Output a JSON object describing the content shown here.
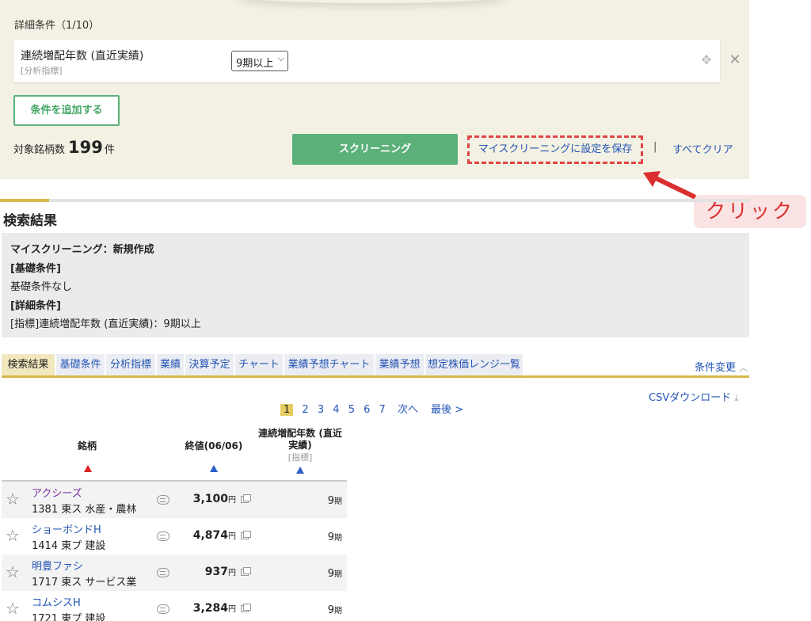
{
  "condition_panel": {
    "heading": "詳細条件（1/10）",
    "condition": {
      "name": "連続増配年数 (直近実績)",
      "sub": "[分析指標]",
      "selected_value": "9期以上"
    },
    "add_button": "条件を追加する",
    "target_label": "対象銘柄数",
    "target_count": "199",
    "target_unit": "件",
    "screening_button": "スクリーニング",
    "save_link": "マイスクリーニングに設定を保存",
    "separator": "|",
    "clear_link": "すべてクリア"
  },
  "annotation": {
    "label": "クリック",
    "color": "#d92f2f"
  },
  "results": {
    "title": "検索結果",
    "summary": {
      "my_screening": "マイスクリーニング：新規作成",
      "basic_heading": "[基礎条件]",
      "basic_value": "基礎条件なし",
      "detail_heading": "[詳細条件]",
      "detail_value": "[指標]連続増配年数 (直近実績)：9期以上"
    }
  },
  "tabs": [
    {
      "label": "検索結果",
      "active": true
    },
    {
      "label": "基礎条件"
    },
    {
      "label": "分析指標"
    },
    {
      "label": "業績"
    },
    {
      "label": "決算予定"
    },
    {
      "label": "チャート"
    },
    {
      "label": "業績予想チャート"
    },
    {
      "label": "業績予想"
    },
    {
      "label": "想定株価レンジ一覧"
    }
  ],
  "condition_change": "条件変更",
  "csv_download": "CSVダウンロード",
  "pager": {
    "current": "1",
    "pages": [
      "2",
      "3",
      "4",
      "5",
      "6",
      "7"
    ],
    "next": "次へ",
    "last": "最後 >"
  },
  "table": {
    "headers": {
      "stock": "銘柄",
      "close": "終値(06/06)",
      "years_line1": "連続増配年数 (直近",
      "years_line2": "実績)",
      "years_sub": "[指標]"
    },
    "rows": [
      {
        "name": "アクシーズ",
        "meta": "1381 東ス 水産・農林",
        "price": "3,100",
        "price_unit": "円",
        "years": "9",
        "years_unit": "期"
      },
      {
        "name": "ショーボンドH",
        "meta": "1414 東プ 建設",
        "price": "4,874",
        "price_unit": "円",
        "years": "9",
        "years_unit": "期"
      },
      {
        "name": "明豊ファシ",
        "meta": "1717 東ス サービス業",
        "price": "937",
        "price_unit": "円",
        "years": "9",
        "years_unit": "期"
      },
      {
        "name": "コムシスH",
        "meta": "1721 東プ 建設",
        "price": "3,284",
        "price_unit": "円",
        "years": "9",
        "years_unit": "期"
      }
    ]
  },
  "colors": {
    "panel_bg": "#f3f1e3",
    "green": "#5cb17a",
    "link_blue": "#2355b5",
    "gold_accent": "#d6b84a",
    "dashed_red": "#e04545"
  }
}
